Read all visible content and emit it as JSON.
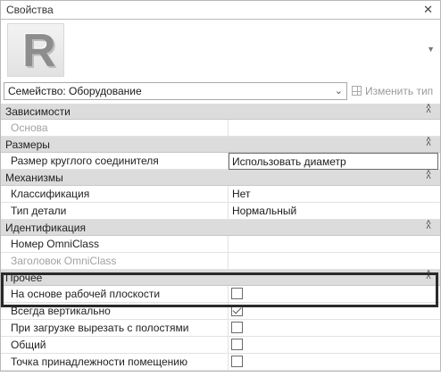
{
  "panel": {
    "title": "Свойства"
  },
  "type_selector": {
    "value": "Семейство: Оборудование",
    "edit_type_label": "Изменить тип"
  },
  "groups": [
    {
      "label": "Зависимости",
      "rows": [
        {
          "name": "Основа",
          "value": "",
          "dim": true,
          "kind": "text"
        }
      ]
    },
    {
      "label": "Размеры",
      "rows": [
        {
          "name": "Размер круглого соединителя",
          "value": "Использовать диаметр",
          "kind": "dropdown"
        }
      ]
    },
    {
      "label": "Механизмы",
      "rows": [
        {
          "name": "Классификация",
          "value": "Нет",
          "kind": "text"
        },
        {
          "name": "Тип детали",
          "value": "Нормальный",
          "kind": "text"
        }
      ]
    },
    {
      "label": "Идентификация",
      "rows": [
        {
          "name": "Номер OmniClass",
          "value": "",
          "kind": "text"
        },
        {
          "name": "Заголовок OmniClass",
          "value": "",
          "dim": true,
          "kind": "text"
        }
      ]
    },
    {
      "label": "Прочее",
      "rows": [
        {
          "name": "На основе рабочей плоскости",
          "checked": false,
          "kind": "checkbox"
        },
        {
          "name": "Всегда вертикально",
          "checked": true,
          "kind": "checkbox"
        },
        {
          "name": "При загрузке вырезать с полостями",
          "checked": false,
          "kind": "checkbox"
        },
        {
          "name": "Общий",
          "checked": false,
          "kind": "checkbox"
        },
        {
          "name": "Точка принадлежности помещению",
          "checked": false,
          "kind": "checkbox"
        }
      ]
    }
  ],
  "colors": {
    "group_header_bg": "#dcdcdc",
    "highlight_border": "#2a2a2a"
  }
}
